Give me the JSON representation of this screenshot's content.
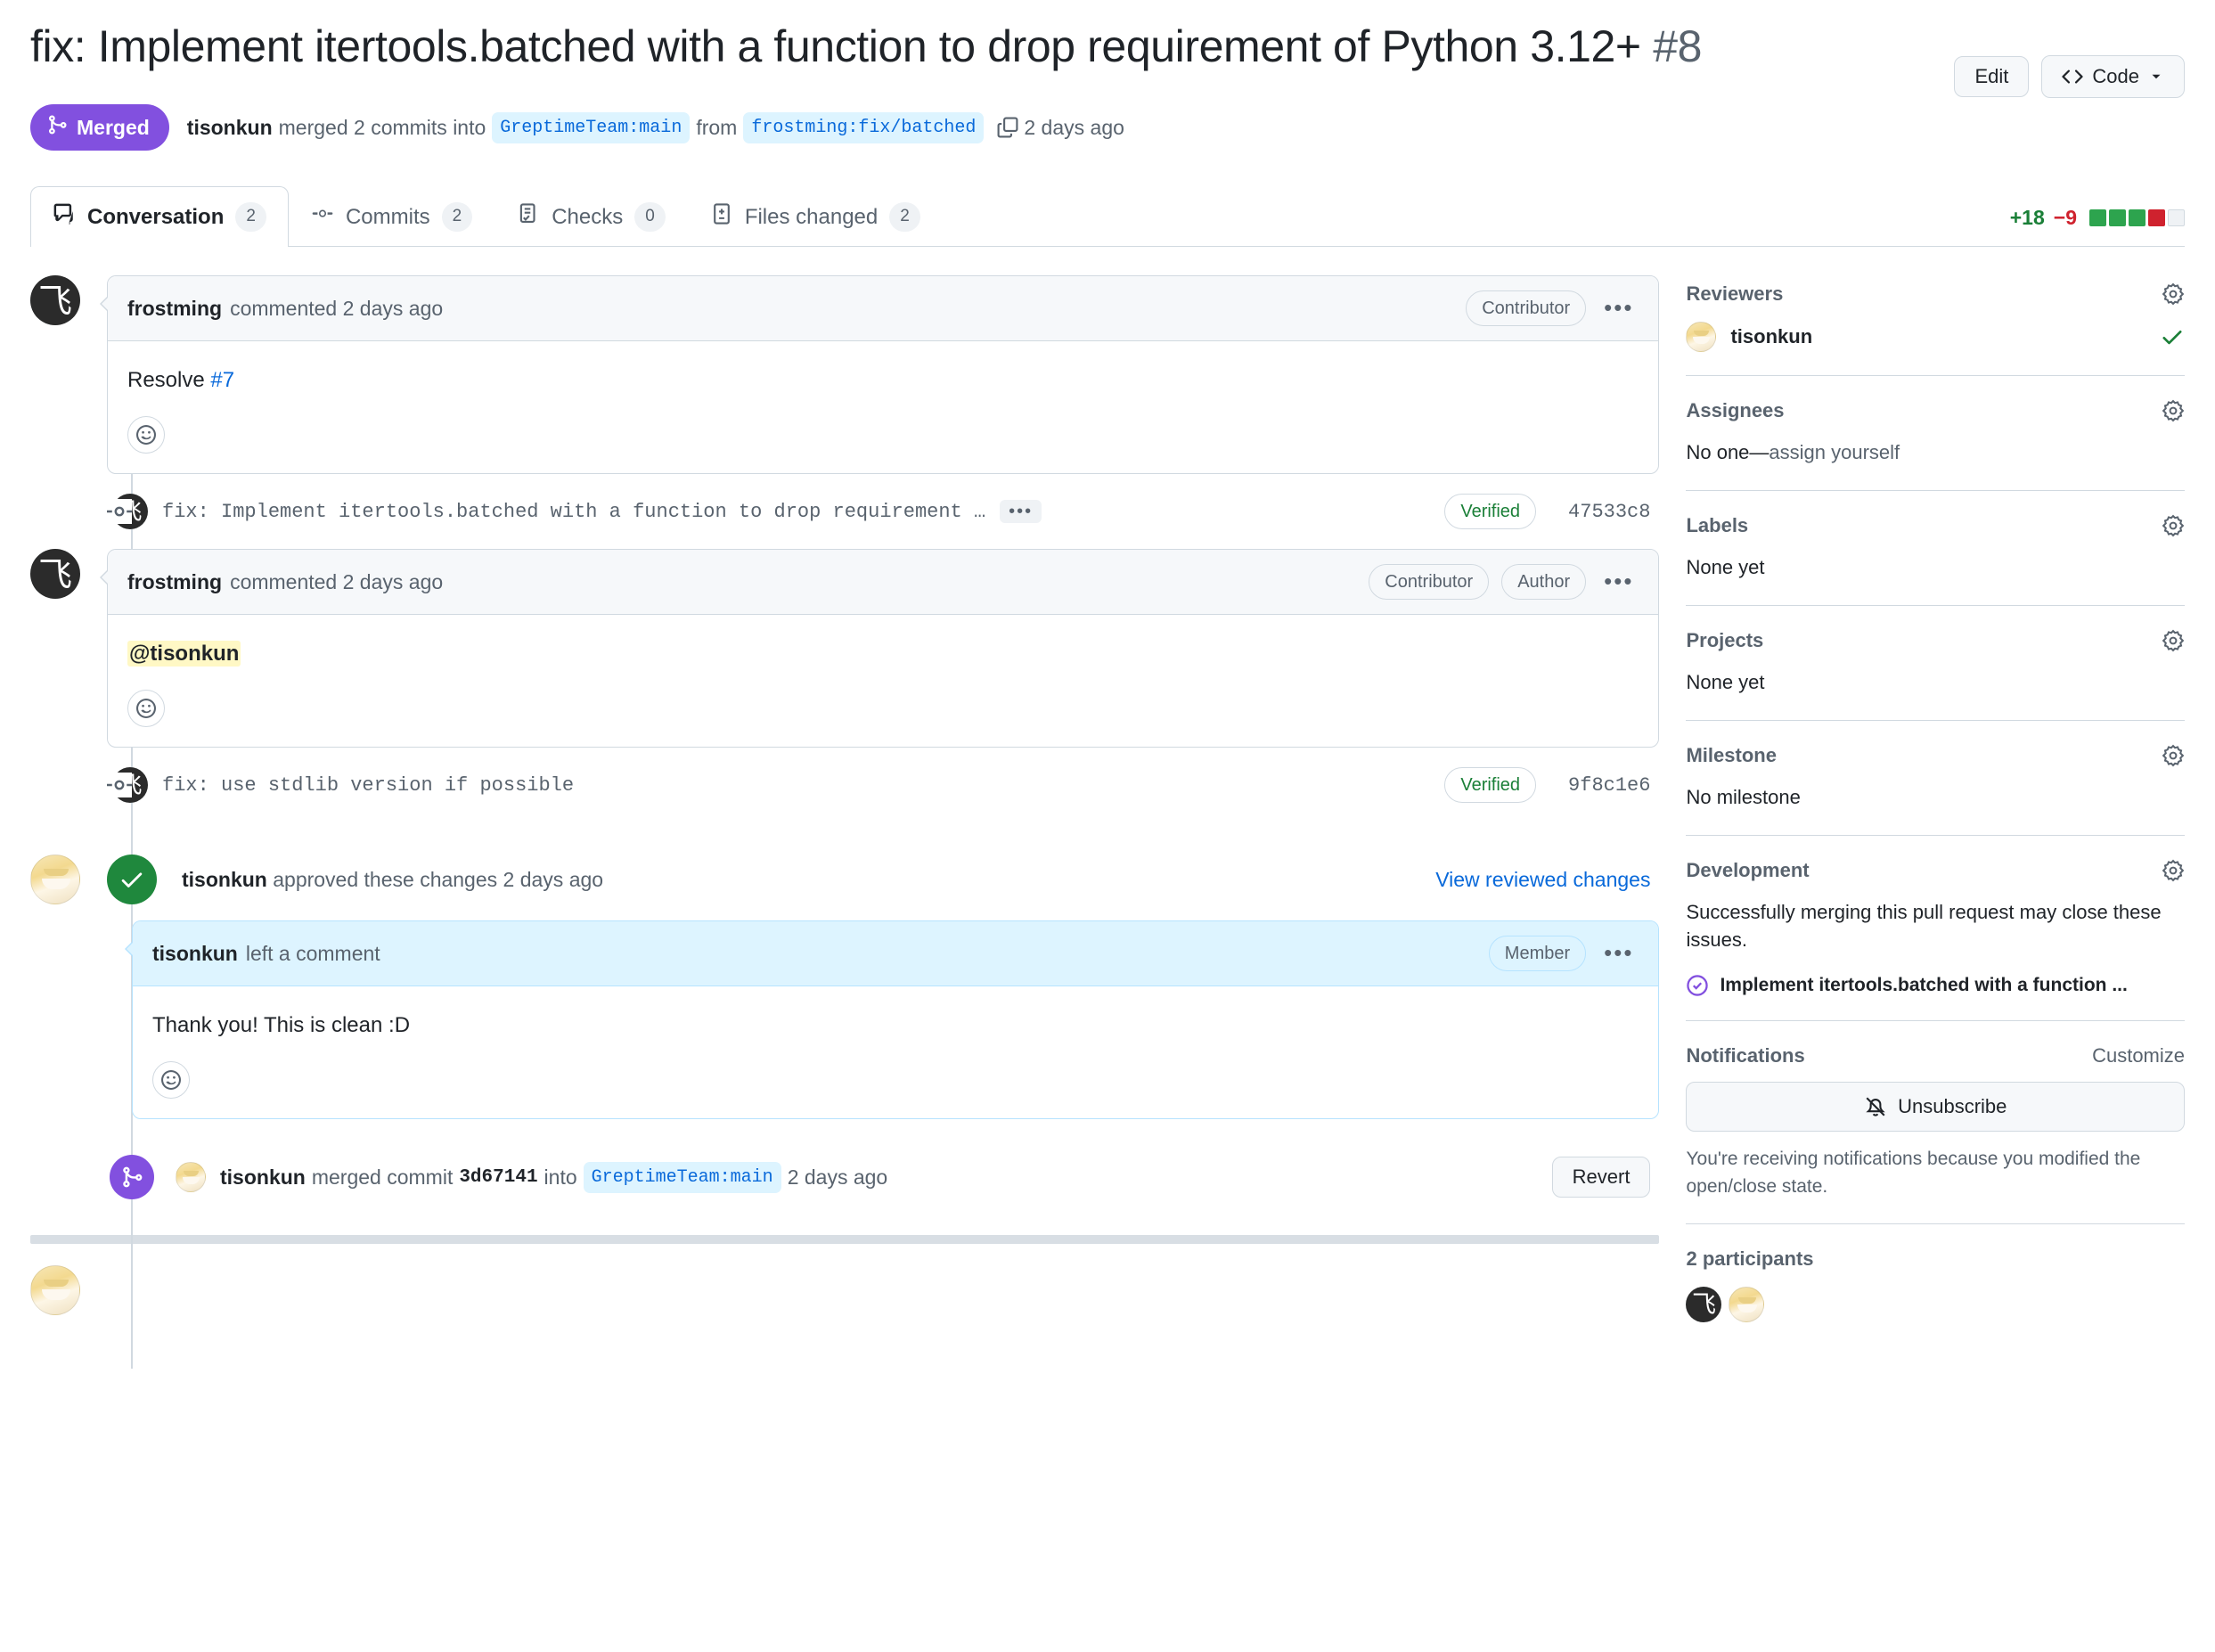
{
  "header": {
    "title": "fix: Implement itertools.batched with a function to drop requirement of Python 3.12+",
    "number": "#8",
    "edit_label": "Edit",
    "code_label": "Code",
    "state": "Merged",
    "merged_by": "tisonkun",
    "merged_text": "merged 2 commits into",
    "base_branch": "GreptimeTeam:main",
    "from_text": "from",
    "head_branch": "frostming:fix/batched",
    "time": "2 days ago"
  },
  "tabs": [
    {
      "label": "Conversation",
      "count": "2",
      "icon": "comment-icon",
      "active": true
    },
    {
      "label": "Commits",
      "count": "2",
      "icon": "commit-icon",
      "active": false
    },
    {
      "label": "Checks",
      "count": "0",
      "icon": "checks-icon",
      "active": false
    },
    {
      "label": "Files changed",
      "count": "2",
      "icon": "diff-icon",
      "active": false
    }
  ],
  "diffstat": {
    "additions": "+18",
    "deletions": "−9",
    "blocks": [
      "g",
      "g",
      "g",
      "r",
      "n"
    ]
  },
  "timeline": {
    "comment1": {
      "author": "frostming",
      "action": "commented 2 days ago",
      "badges": [
        "Contributor"
      ],
      "body_prefix": "Resolve ",
      "body_link": "#7"
    },
    "commit1": {
      "message": "fix: Implement itertools.batched with a function to drop requirement …",
      "more": "•••",
      "verified": "Verified",
      "sha": "47533c8"
    },
    "comment2": {
      "author": "frostming",
      "action": "commented 2 days ago",
      "badges": [
        "Contributor",
        "Author"
      ],
      "mention": "@tisonkun"
    },
    "commit2": {
      "message": "fix: use stdlib version if possible",
      "verified": "Verified",
      "sha": "9f8c1e6"
    },
    "approval": {
      "author": "tisonkun",
      "action": "approved these changes 2 days ago",
      "link": "View reviewed changes"
    },
    "comment3": {
      "author": "tisonkun",
      "action": "left a comment",
      "badges": [
        "Member"
      ],
      "body": "Thank you! This is clean :D"
    },
    "merge_event": {
      "author": "tisonkun",
      "text_before": "merged commit",
      "sha": "3d67141",
      "text_mid": "into",
      "branch": "GreptimeTeam:main",
      "time": "2 days ago",
      "revert_label": "Revert"
    }
  },
  "sidebar": {
    "reviewers": {
      "title": "Reviewers",
      "items": [
        {
          "name": "tisonkun",
          "status": "approved"
        }
      ]
    },
    "assignees": {
      "title": "Assignees",
      "empty_prefix": "No one—",
      "empty_link": "assign yourself"
    },
    "labels": {
      "title": "Labels",
      "value": "None yet"
    },
    "projects": {
      "title": "Projects",
      "value": "None yet"
    },
    "milestone": {
      "title": "Milestone",
      "value": "No milestone"
    },
    "development": {
      "title": "Development",
      "description": "Successfully merging this pull request may close these issues.",
      "issue": "Implement itertools.batched with a function ..."
    },
    "notifications": {
      "title": "Notifications",
      "customize": "Customize",
      "button": "Unsubscribe",
      "note": "You're receiving notifications because you modified the open/close state."
    },
    "participants": {
      "title": "2 participants",
      "avatars": [
        "frostming",
        "tisonkun"
      ]
    }
  },
  "colors": {
    "merged_purple": "#8250df",
    "approved_green": "#1f883d",
    "link_blue": "#0969da",
    "add_green": "#1a7f37",
    "del_red": "#cf222e"
  }
}
